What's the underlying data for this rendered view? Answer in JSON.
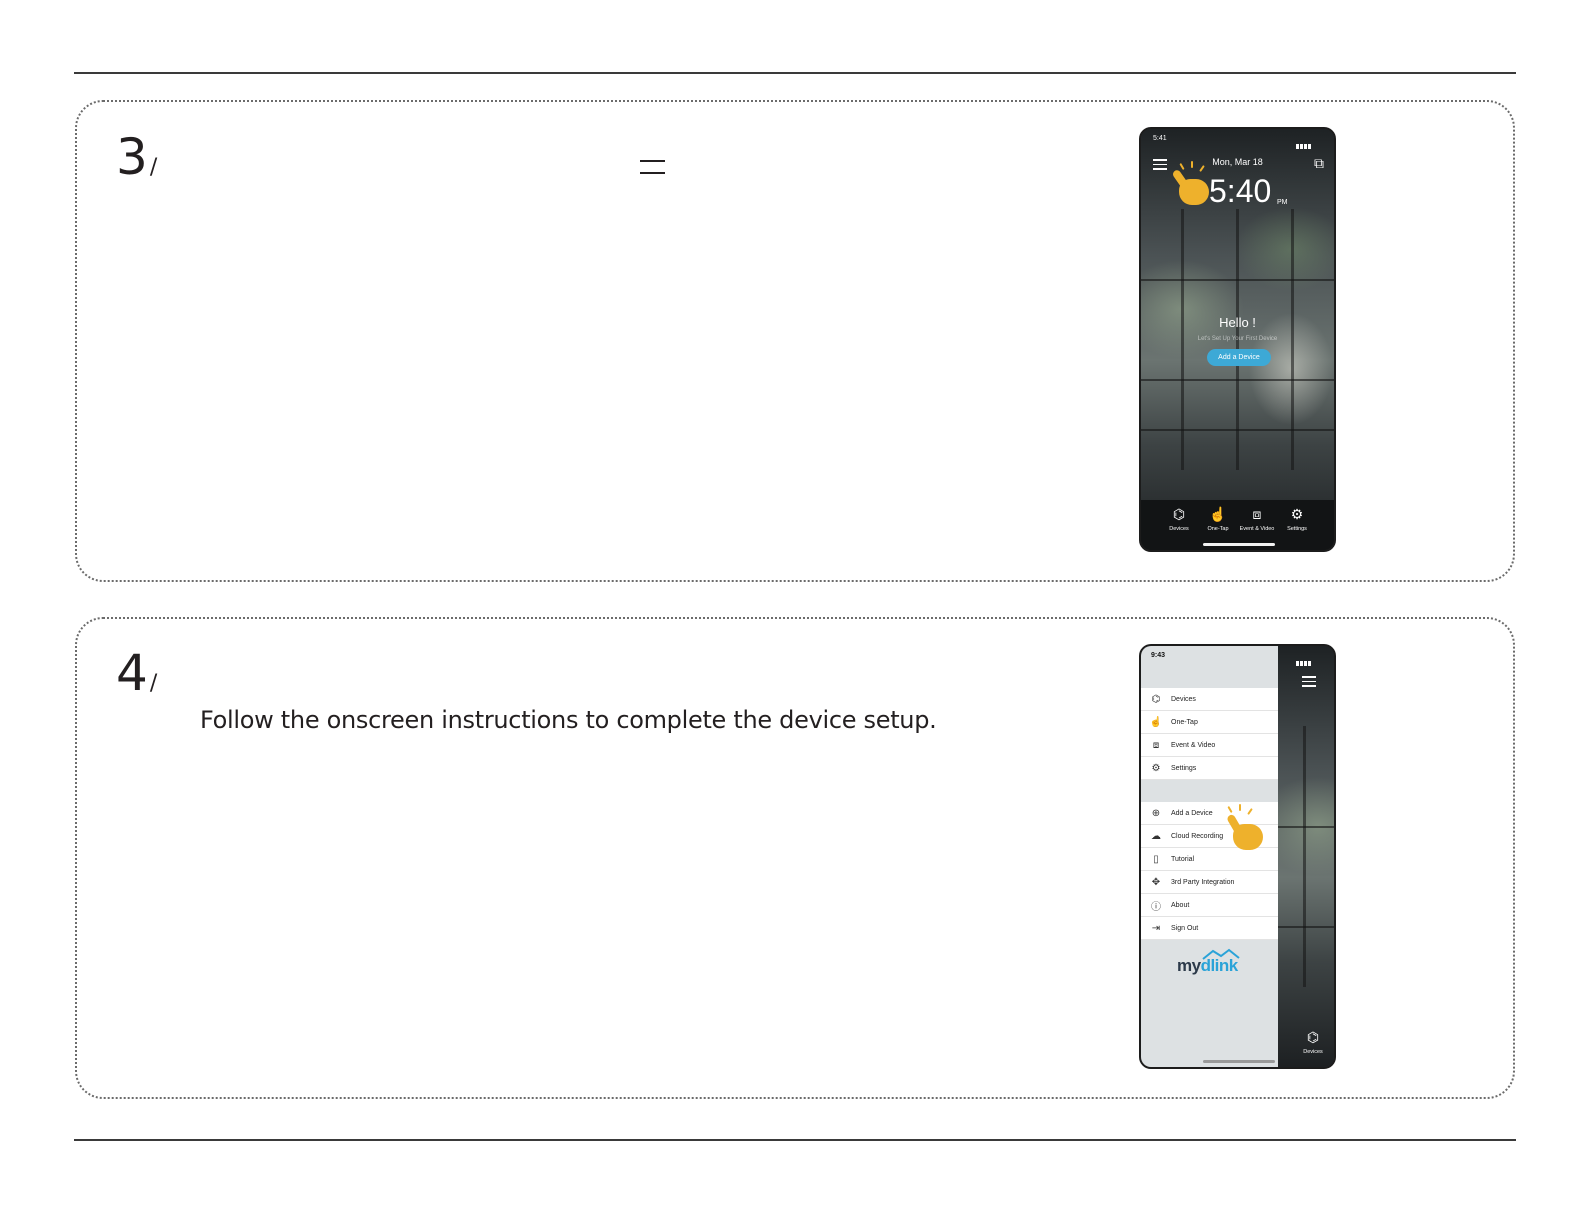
{
  "step3": {
    "number": "3",
    "phone": {
      "status_time": "5:41",
      "date": "Mon, Mar 18",
      "clock": "5:40",
      "ampm": "PM",
      "hello": "Hello !",
      "subtitle": "Let's Set Up Your First Device",
      "add_button": "Add a Device",
      "tabs": [
        {
          "label": "Devices",
          "icon": "devices-icon"
        },
        {
          "label": "One-Tap",
          "icon": "one-tap-icon"
        },
        {
          "label": "Event & Video",
          "icon": "event-video-icon"
        },
        {
          "label": "Settings",
          "icon": "settings-icon"
        }
      ]
    }
  },
  "step4": {
    "number": "4",
    "instruction": "Follow the onscreen instructions to complete the device setup.",
    "phone": {
      "status_time": "9:43",
      "menu_primary": [
        {
          "label": "Devices",
          "icon": "devices-icon"
        },
        {
          "label": "One-Tap",
          "icon": "one-tap-icon"
        },
        {
          "label": "Event & Video",
          "icon": "event-video-icon"
        },
        {
          "label": "Settings",
          "icon": "settings-icon"
        }
      ],
      "menu_secondary": [
        {
          "label": "Add a Device",
          "icon": "plus-circle-icon"
        },
        {
          "label": "Cloud Recording",
          "icon": "cloud-icon"
        },
        {
          "label": "Tutorial",
          "icon": "book-icon"
        },
        {
          "label": "3rd Party Integration",
          "icon": "handshake-icon"
        },
        {
          "label": "About",
          "icon": "info-icon"
        },
        {
          "label": "Sign Out",
          "icon": "sign-out-icon"
        }
      ],
      "brand_my": "my",
      "brand_dlink": "dlink",
      "side_tab": "Devices"
    }
  },
  "colors": {
    "accent_blue": "#3da9d6",
    "hand_yellow": "#eeb12c",
    "rule": "#3a3a3a"
  }
}
